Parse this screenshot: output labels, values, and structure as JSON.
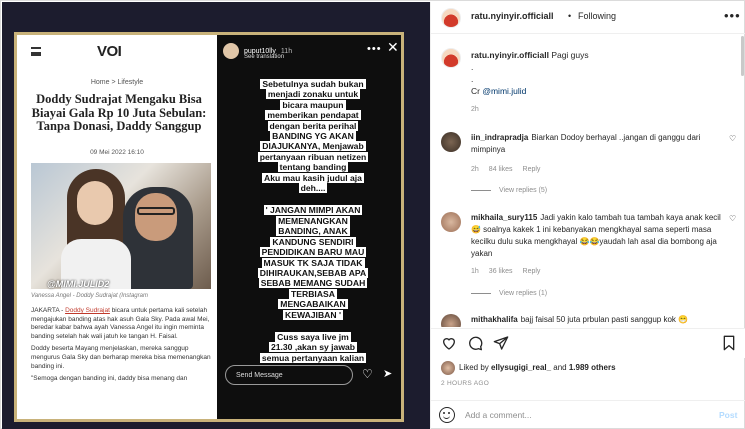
{
  "media": {
    "site_logo": "VOI",
    "breadcrumb": "Home > Lifestyle",
    "headline": "Doddy Sudrajat Mengaku Bisa Biayai Gala Rp 10 Juta Sebulan: Tanpa Donasi, Daddy Sanggup",
    "date": "09 Mei 2022 16:10",
    "photo_tag": "@MIMI.JULID2",
    "photo_caption": "Vanessa Angel - Doddy Sudrajat (Instagram",
    "paragraphs": [
      [
        "JAKARTA - ",
        "Doddy Sudrajat",
        " bicara untuk pertama kali setelah mengajukan banding atas hak asuh Gala Sky. Pada awal Mei, beredar kabar bahwa ayah Vanessa Angel itu ingin meminta banding setelah hak wali jatuh ke tangan H. Faisal."
      ],
      [
        "",
        "",
        "Doddy beserta Mayang menjelaskan, mereka sanggup mengurus Gala Sky dan berharap mereka bisa memenangkan banding ini."
      ],
      [
        "",
        "",
        "\"Semoga dengan banding ini, daddy bisa menang dan"
      ]
    ],
    "story": {
      "username": "puput10lly",
      "time": "11h",
      "see_translation": "See translation",
      "more": "•••",
      "close": "✕",
      "block1": [
        "Sebetulnya sudah bukan",
        "menjadi zonaku untuk",
        "bicara maupun",
        "memberikan pendapat",
        "dengan berita perihal",
        "BANDING YG AKAN",
        "DIAJUKANYA, Menjawab",
        "pertanyaan ribuan netizen",
        "tentang banding",
        "Aku mau kasih judul aja",
        "deh...."
      ],
      "block2": [
        "' JANGAN MIMPI AKAN",
        "MEMENANGKAN",
        "BANDING, ANAK",
        "KANDUNG SENDIRI",
        "PENDIDIKAN BARU MAU",
        "MASUK TK SAJA TIDAK",
        "DIHIRAUKAN,SEBAB APA",
        "SEBAB MEMANG SUDAH",
        "TERBIASA",
        "MENGABAIKAN",
        "KEWAJIBAN '"
      ],
      "block3": [
        "Cuss saya live jm",
        "21.30 ,akan sy jawab",
        "semua pertanyaan kalian"
      ],
      "send_placeholder": "Send Message"
    }
  },
  "header": {
    "username": "ratu.nyinyir.officiall",
    "dot": "•",
    "follow_label": "Following",
    "more": "•••"
  },
  "caption": {
    "username": "ratu.nyinyir.officiall",
    "text": "Pagi guys",
    "line2": ".",
    "line3": ".",
    "credit_prefix": "Cr ",
    "credit_handle": "@mimi.julid",
    "time": "2h"
  },
  "comments": [
    {
      "username": "iin_indrapradja",
      "text": "Biarkan Dodoy berhayal ..jangan di ganggu dari mimpinya",
      "time": "2h",
      "likes": "84 likes",
      "reply": "Reply",
      "view": "View replies (5)"
    },
    {
      "username": "mikhaila_sury115",
      "text": "Jadi yakin kalo tambah tua tambah kaya anak kecil 😅 soalnya kakek 1 ini kebanyakan mengkhayal sama seperti masa kecilku dulu suka mengkhayal 😂😂yaudah lah asal dia bombong aja yakan",
      "time": "1h",
      "likes": "36 likes",
      "reply": "Reply",
      "view": "View replies (1)"
    },
    {
      "username": "mithakhalifa",
      "text": "bajj faisal 50 juta prbulan pasti sanggup kok 😁"
    }
  ],
  "likes": {
    "prefix": "Liked by ",
    "user": "ellysugigi_real_",
    "middle": " and ",
    "count": "1.989 others"
  },
  "posted": "2 HOURS AGO",
  "add_comment": {
    "placeholder": "Add a comment...",
    "post_label": "Post"
  },
  "colors": {
    "link": "#00376b",
    "post_disabled": "#b3dbff",
    "frame_gold": "#c8b27a"
  }
}
